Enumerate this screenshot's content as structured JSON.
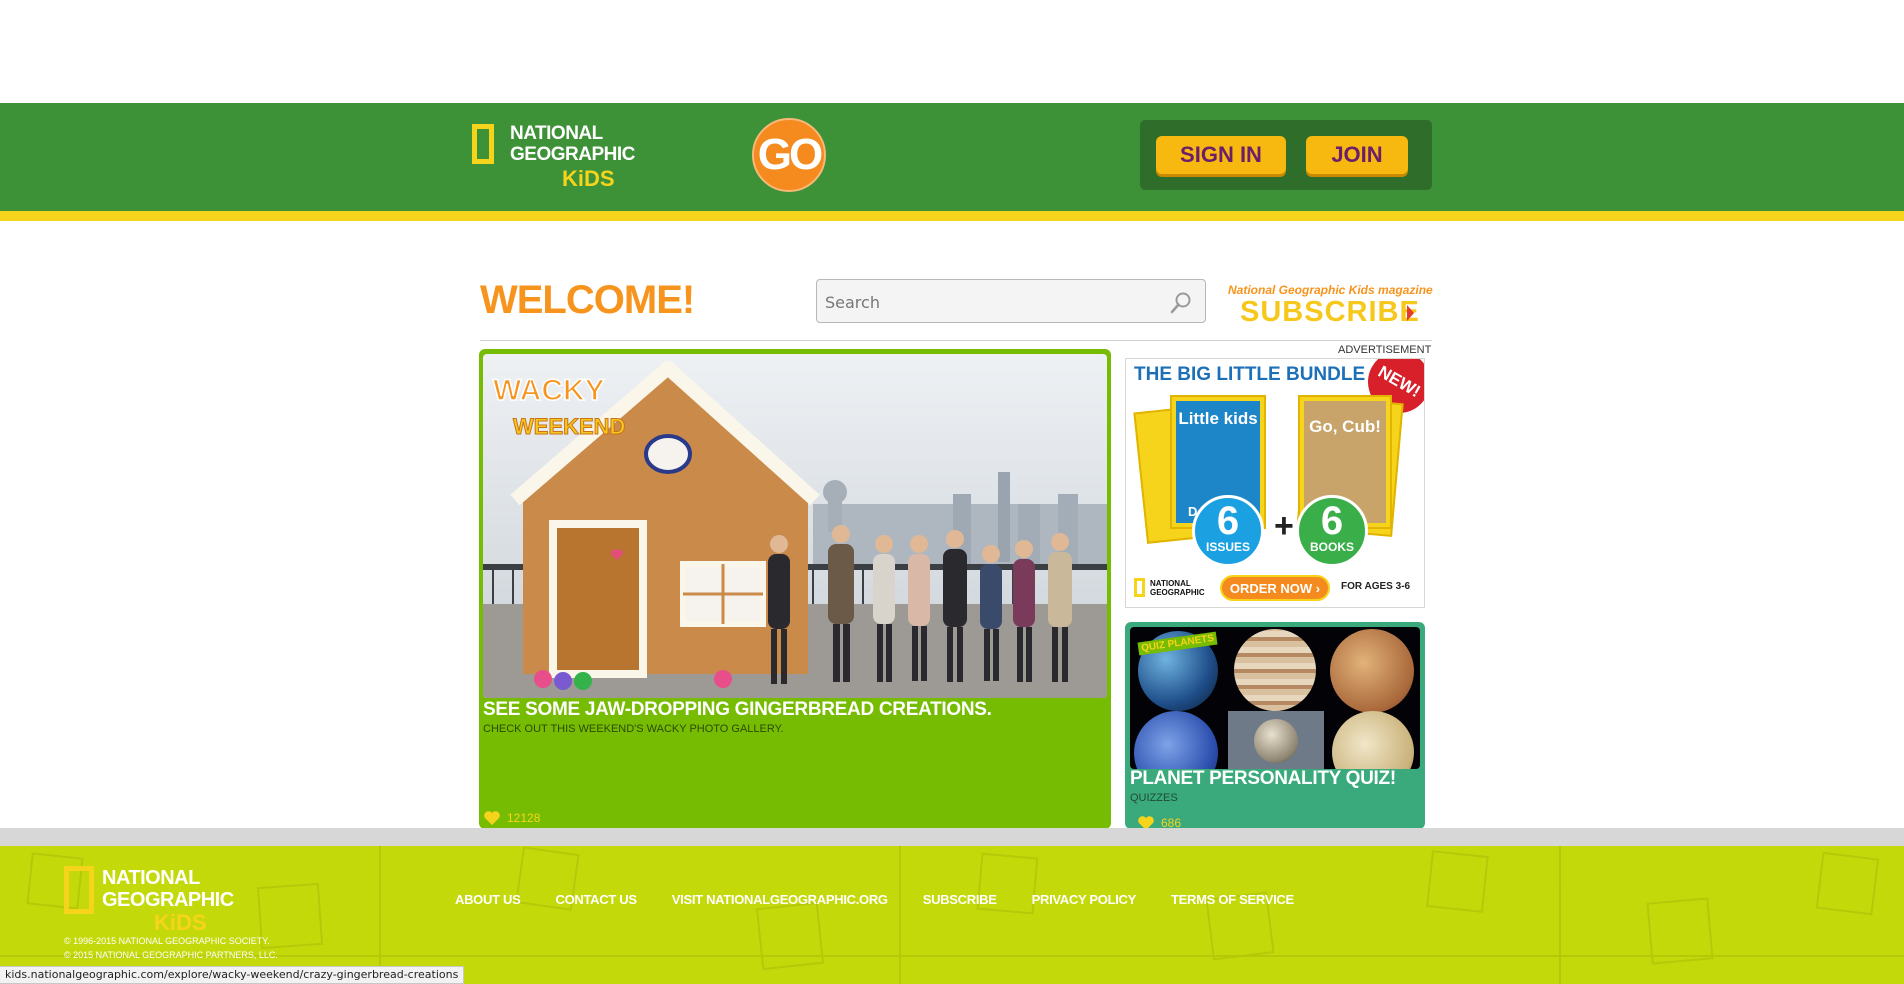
{
  "header": {
    "logo": {
      "line1": "NATIONAL",
      "line2": "GEOGRAPHIC",
      "line3": "KiDS"
    },
    "go_label": "GO",
    "sign_in_label": "SIGN IN",
    "join_label": "JOIN",
    "colors": {
      "bar": "#3d9137",
      "stripe": "#f7d41c",
      "button": "#f7b80f",
      "button_text": "#6b1f6b"
    }
  },
  "welcome": {
    "title": "WELCOME!",
    "search_placeholder": "Search",
    "subscribe_tagline": "National Geographic Kids magazine",
    "subscribe_label": "SUBSCRIBE"
  },
  "feature": {
    "badge_top": "WACKY",
    "badge_bottom": "WEEKEND",
    "title": "SEE SOME JAW-DROPPING GINGERBREAD CREATIONS.",
    "subtitle": "CHECK OUT THIS WEEKEND'S WACKY PHOTO GALLERY.",
    "likes": "12128",
    "icon": "heart-icon"
  },
  "ad": {
    "label": "ADVERTISEMENT",
    "title": "THE BIG LITTLE BUNDLE",
    "badge": "NEW!",
    "mag1_title": "Little kids",
    "mag1_cover": "Dolphins!",
    "mag2_title": "Go, Cub!",
    "issues_count": "6",
    "issues_label": "ISSUES",
    "books_count": "6",
    "books_label": "BOOKS",
    "plus": "+",
    "logo_line1": "NATIONAL",
    "logo_line2": "GEOGRAPHIC",
    "order_label": "ORDER NOW",
    "ages": "FOR AGES 3-6"
  },
  "quiz": {
    "tag": "QUIZ PLANETS",
    "title": "PLANET PERSONALITY QUIZ!",
    "category": "QUIZZES",
    "likes": "686"
  },
  "footer": {
    "logo": {
      "line1": "NATIONAL",
      "line2": "GEOGRAPHIC",
      "line3": "KiDS"
    },
    "nav": [
      "ABOUT US",
      "CONTACT US",
      "VISIT NATIONALGEOGRAPHIC.ORG",
      "SUBSCRIBE",
      "PRIVACY POLICY",
      "TERMS OF SERVICE"
    ],
    "copyright1": "© 1996-2015 NATIONAL GEOGRAPHIC SOCIETY.",
    "copyright2": "© 2015 NATIONAL GEOGRAPHIC PARTNERS, LLC."
  },
  "status_url": "kids.nationalgeographic.com/explore/wacky-weekend/crazy-gingerbread-creations"
}
